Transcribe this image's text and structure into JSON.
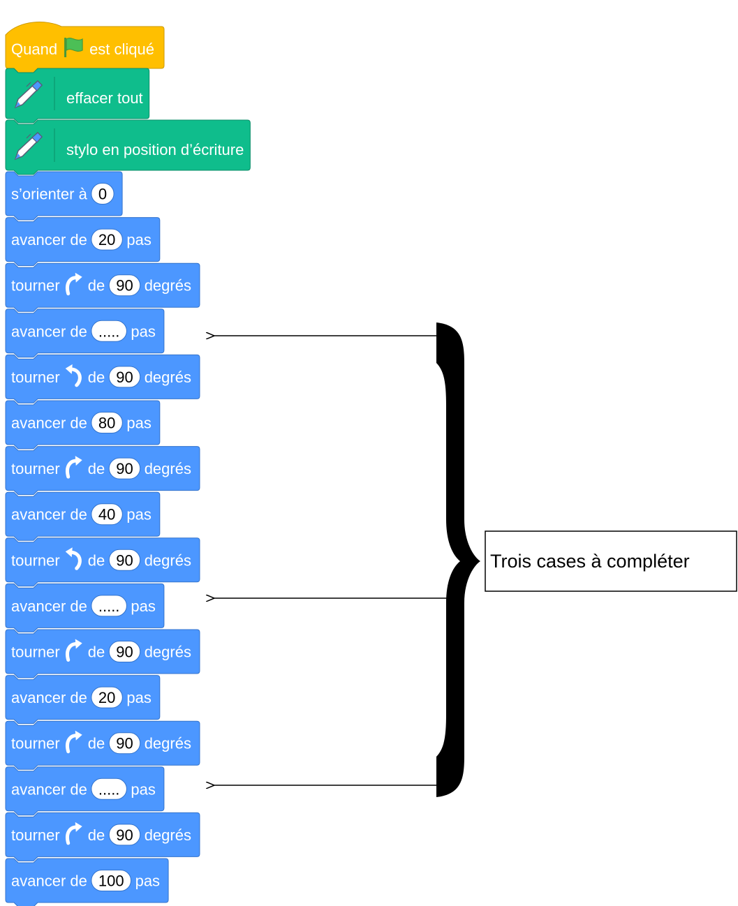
{
  "hat": {
    "text_before": "Quand",
    "text_after": "est cliqué",
    "icon": "green-flag-icon",
    "color": "#FFBF00"
  },
  "pen_blocks": [
    {
      "text": "effacer tout",
      "icon": "pen-icon"
    },
    {
      "text": "stylo en position d’écriture",
      "icon": "pen-icon"
    }
  ],
  "colors": {
    "hat": "#FFBF00",
    "pen": "#0FBD8C",
    "motion": "#4C97FF",
    "pill": "#FFFFFF",
    "text": "#FFFFFF"
  },
  "motion_blocks": [
    {
      "kind": "orient",
      "parts": [
        "s’orienter à",
        "0",
        ""
      ]
    },
    {
      "kind": "move",
      "parts": [
        "avancer de",
        "20",
        "pas"
      ]
    },
    {
      "kind": "turn",
      "dir": "left",
      "parts": [
        "tourner",
        "de",
        "90",
        "degrés"
      ]
    },
    {
      "kind": "move",
      "parts": [
        "avancer de",
        ".....",
        "pas"
      ]
    },
    {
      "kind": "turn",
      "dir": "right",
      "parts": [
        "tourner",
        "de",
        "90",
        "degrés"
      ]
    },
    {
      "kind": "move",
      "parts": [
        "avancer de",
        "80",
        "pas"
      ]
    },
    {
      "kind": "turn",
      "dir": "left",
      "parts": [
        "tourner",
        "de",
        "90",
        "degrés"
      ]
    },
    {
      "kind": "move",
      "parts": [
        "avancer de",
        "40",
        "pas"
      ]
    },
    {
      "kind": "turn",
      "dir": "right",
      "parts": [
        "tourner",
        "de",
        "90",
        "degrés"
      ]
    },
    {
      "kind": "move",
      "parts": [
        "avancer de",
        ".....",
        "pas"
      ]
    },
    {
      "kind": "turn",
      "dir": "left",
      "parts": [
        "tourner",
        "de",
        "90",
        "degrés"
      ]
    },
    {
      "kind": "move",
      "parts": [
        "avancer de",
        "20",
        "pas"
      ]
    },
    {
      "kind": "turn",
      "dir": "left",
      "parts": [
        "tourner",
        "de",
        "90",
        "degrés"
      ]
    },
    {
      "kind": "move",
      "parts": [
        "avancer de",
        ".....",
        "pas"
      ]
    },
    {
      "kind": "turn",
      "dir": "left",
      "parts": [
        "tourner",
        "de",
        "90",
        "degrés"
      ]
    },
    {
      "kind": "move",
      "parts": [
        "avancer de",
        "100",
        "pas"
      ]
    }
  ],
  "annotation": {
    "label": "Trois cases à compléter",
    "targets_block_index": [
      3,
      9,
      13
    ]
  }
}
